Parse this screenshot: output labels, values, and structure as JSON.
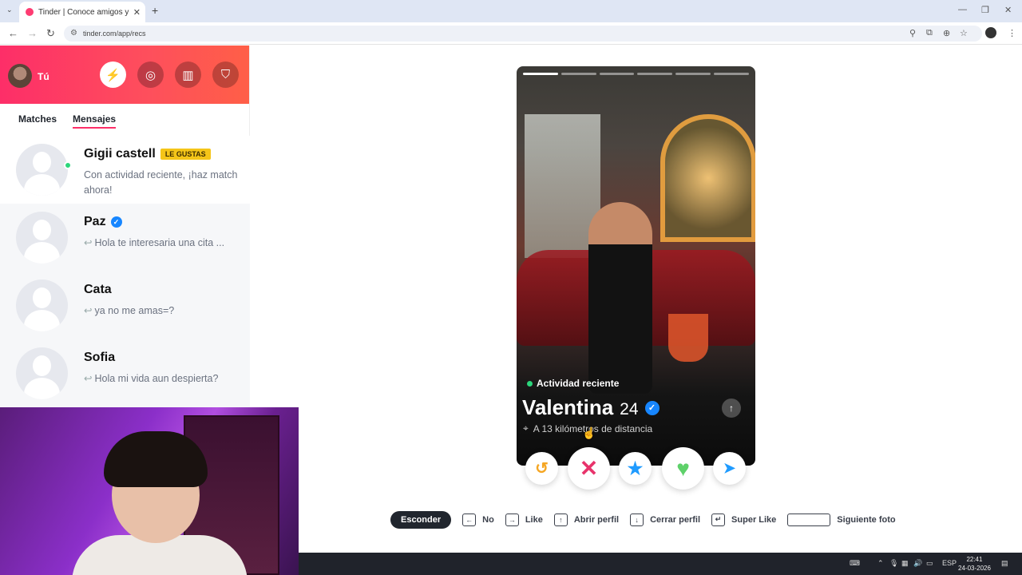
{
  "browser": {
    "tab_title": "Tinder | Conoce amigos y gente",
    "url": "tinder.com/app/recs"
  },
  "sidebar": {
    "me_label": "Tú",
    "tabs": [
      {
        "label": "Matches",
        "selected": false
      },
      {
        "label": "Mensajes",
        "selected": true
      }
    ],
    "conversations": [
      {
        "name": "Gigii castell",
        "badge": "LE GUSTAS",
        "message": "Con actividad reciente, ¡haz match ahora!",
        "online": true
      },
      {
        "name": "Paz",
        "verified": true,
        "message": "Hola te interesaria una cita ..."
      },
      {
        "name": "Cata",
        "message": "ya no me amas=?"
      },
      {
        "name": "Sofia",
        "message": "Hola mi vida aun despierta?"
      }
    ]
  },
  "profile": {
    "activity": "Actividad reciente",
    "name": "Valentina",
    "age": "24",
    "distance": "A 13 kilómetros de distancia",
    "photo_count": 6,
    "current_photo": 1
  },
  "hints": {
    "hide": "Esconder",
    "no": "No",
    "like": "Like",
    "open_profile": "Abrir perfil",
    "close_profile": "Cerrar perfil",
    "super_like": "Super Like",
    "next_photo": "Siguiente foto"
  },
  "taskbar": {
    "lang": "ESP",
    "time": "22:41",
    "date": "24-03-2026"
  },
  "colors": {
    "brand": "#fd2e68",
    "nope": "#e8336b",
    "like": "#5ed16a",
    "super": "#1f9bff"
  }
}
